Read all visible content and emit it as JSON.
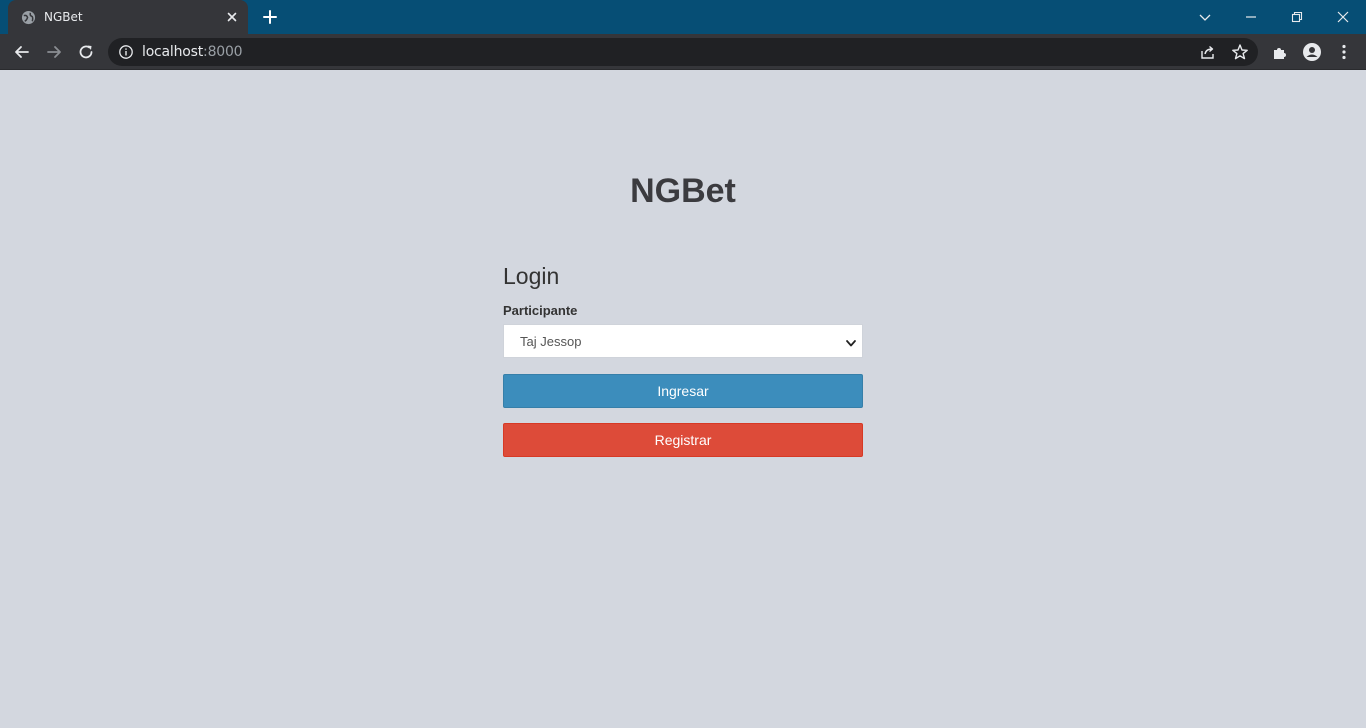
{
  "browser": {
    "tab": {
      "title": "NGBet"
    },
    "address": {
      "host": "localhost",
      "port": ":8000"
    }
  },
  "page": {
    "brand": "NGBet",
    "login": {
      "heading": "Login",
      "participant_label": "Participante",
      "participant_selected": "Taj Jessop",
      "login_button": "Ingresar",
      "register_button": "Registrar"
    }
  },
  "colors": {
    "page_background": "#d3d7df",
    "primary_button": "#3c8dbc",
    "danger_button": "#dd4b39",
    "tabstrip": "#064e75"
  },
  "icons": {
    "tab_favicon": "globe-icon",
    "tab_close": "close-icon",
    "new_tab": "plus-icon",
    "back": "arrow-left-icon",
    "forward": "arrow-right-icon",
    "reload": "reload-icon",
    "site_info": "info-icon",
    "share": "share-icon",
    "bookmark": "star-icon",
    "extensions": "puzzle-icon",
    "profile": "profile-icon",
    "menu": "kebab-menu-icon",
    "tab_search": "chevron-down-icon",
    "minimize": "minimize-icon",
    "restore": "restore-icon",
    "close_window": "close-window-icon"
  }
}
